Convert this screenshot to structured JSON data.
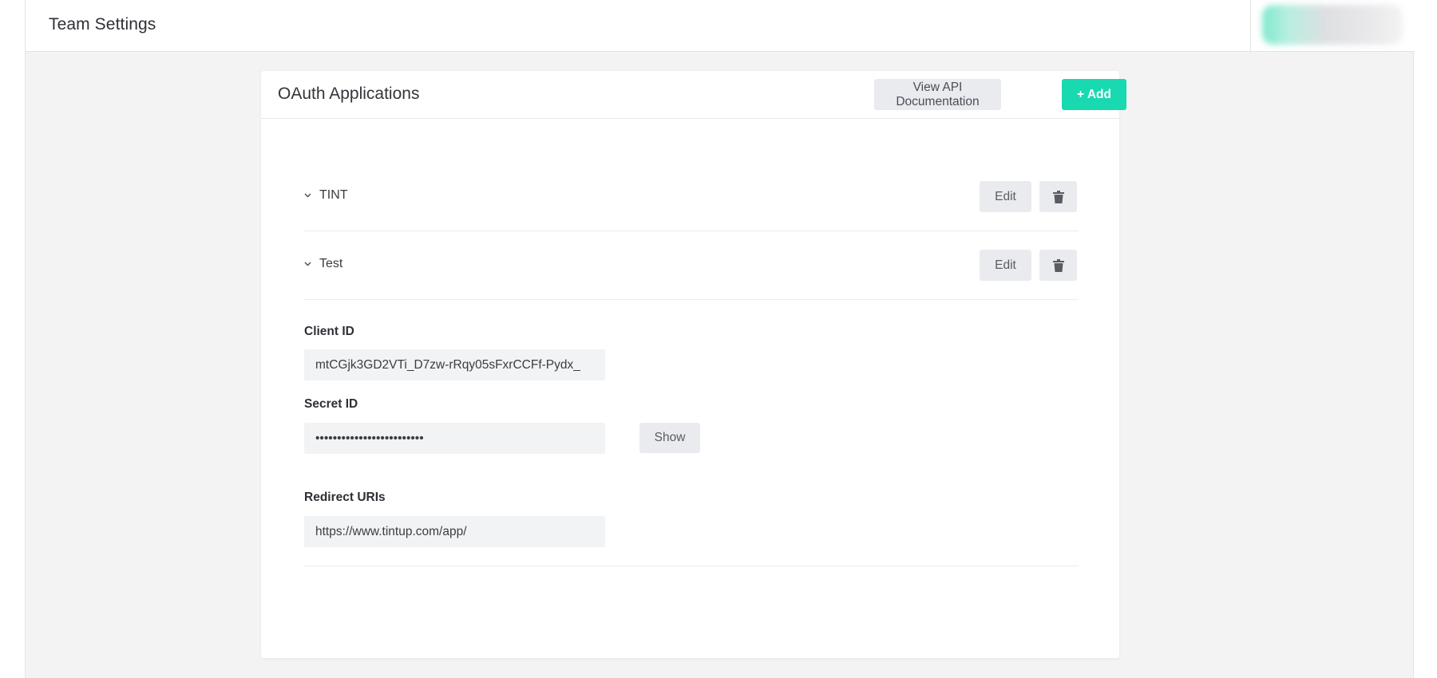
{
  "header": {
    "title": "Team Settings"
  },
  "card": {
    "title": "OAuth Applications",
    "docs_label": "View API Documentation",
    "add_label": "+ Add"
  },
  "apps": [
    {
      "name": "TINT",
      "edit_label": "Edit",
      "chevron_icon": "chevron-down-icon",
      "delete_icon": "trash-icon"
    },
    {
      "name": "Test",
      "edit_label": "Edit",
      "chevron_icon": "chevron-down-icon",
      "delete_icon": "trash-icon"
    }
  ],
  "details": {
    "client_id_label": "Client ID",
    "client_id_value": "mtCGjk3GD2VTi_D7zw-rRqy05sFxrCCFf-Pydx_",
    "secret_label": "Secret ID",
    "secret_value": "•••••••••••••••••••••••••",
    "show_label": "Show",
    "redirect_label": "Redirect URIs",
    "redirect_value": "https://www.tintup.com/app/"
  },
  "colors": {
    "accent": "#18d9b0",
    "button_gray": "#e9ebef",
    "page_bg": "#f3f3f4"
  }
}
